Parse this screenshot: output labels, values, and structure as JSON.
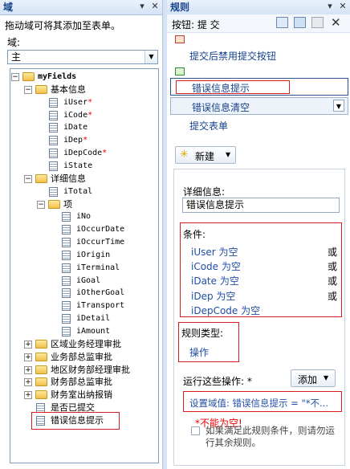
{
  "left_pane": {
    "title": "域",
    "hint": "拖动域可将其添加至表单。",
    "field_label": "域:",
    "field_select_value": "主",
    "tree": [
      {
        "label": "myFields",
        "type": "folder",
        "expand": "-",
        "bold": true,
        "mono": true
      },
      {
        "label": "基本信息",
        "type": "folder",
        "expand": "-"
      },
      {
        "label": "iUser",
        "type": "field",
        "required": true,
        "mono": true
      },
      {
        "label": "iCode",
        "type": "field",
        "required": true,
        "mono": true
      },
      {
        "label": "iDate",
        "type": "field",
        "mono": true
      },
      {
        "label": "iDep",
        "type": "field",
        "required": true,
        "mono": true
      },
      {
        "label": "iDepCode",
        "type": "field",
        "required": true,
        "mono": true
      },
      {
        "label": "iState",
        "type": "field",
        "mono": true
      },
      {
        "label": "详细信息",
        "type": "folder",
        "expand": "-"
      },
      {
        "label": "iTotal",
        "type": "field",
        "mono": true
      },
      {
        "label": "项",
        "type": "folder",
        "expand": "-"
      },
      {
        "label": "iNo",
        "type": "field",
        "mono": true
      },
      {
        "label": "iOccurDate",
        "type": "field",
        "mono": true
      },
      {
        "label": "iOccurTime",
        "type": "field",
        "mono": true
      },
      {
        "label": "iOrigin",
        "type": "field",
        "mono": true
      },
      {
        "label": "iTerminal",
        "type": "field",
        "mono": true
      },
      {
        "label": "iGoal",
        "type": "field",
        "mono": true
      },
      {
        "label": "iOtherGoal",
        "type": "field",
        "mono": true
      },
      {
        "label": "iTransport",
        "type": "field",
        "mono": true
      },
      {
        "label": "iDetail",
        "type": "field",
        "mono": true
      },
      {
        "label": "iAmount",
        "type": "field",
        "mono": true
      },
      {
        "label": "区域业务经理审批",
        "type": "folder",
        "expand": "+"
      },
      {
        "label": "业务部总监审批",
        "type": "folder",
        "expand": "+"
      },
      {
        "label": "地区财务部经理审批",
        "type": "folder",
        "expand": "+"
      },
      {
        "label": "财务部总监审批",
        "type": "folder",
        "expand": "+"
      },
      {
        "label": "财务室出纳报销",
        "type": "folder",
        "expand": "+"
      },
      {
        "label": "是否已提交",
        "type": "field"
      },
      {
        "label": "错误信息提示",
        "type": "field"
      }
    ],
    "required_mark": "*"
  },
  "right_pane": {
    "title": "规则",
    "control_label": "按钮: 提 交",
    "rules": [
      {
        "label": "提交后禁用提交按钮"
      },
      {
        "label": "错误信息提示"
      },
      {
        "label": "错误信息清空"
      }
    ],
    "submit_form_label": "提交表单",
    "new_button": "新建",
    "details_label": "详细信息:",
    "details_value": "错误信息提示",
    "condition_label": "条件:",
    "conditions": [
      {
        "text": "iUser 为空",
        "op": "或"
      },
      {
        "text": "iCode 为空",
        "op": "或"
      },
      {
        "text": "iDate 为空",
        "op": "或"
      },
      {
        "text": "iDep 为空",
        "op": "或"
      },
      {
        "text": "iDepCode 为空",
        "op": ""
      }
    ],
    "rule_type_label": "规则类型:",
    "rule_type_value": "操作",
    "run_actions_label": "运行这些操作: *",
    "add_button": "添加",
    "action_text": "设置域值: 错误信息提示 = \"*不...",
    "annotation": "*不能为空!",
    "checkbox_text": "如果满足此规则条件，则请勿运行其余规则。"
  }
}
